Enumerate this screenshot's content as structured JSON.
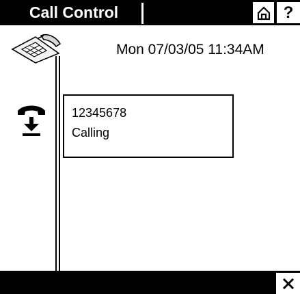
{
  "header": {
    "title": "Call Control",
    "home_icon": "home-icon",
    "help_label": "?"
  },
  "status": {
    "datetime": "Mon 07/03/05 11:34AM"
  },
  "icons": {
    "phone": "desk-phone-icon",
    "call_action": "accept-call-icon",
    "close": "close-icon"
  },
  "call": {
    "number": "12345678",
    "state": "Calling"
  }
}
